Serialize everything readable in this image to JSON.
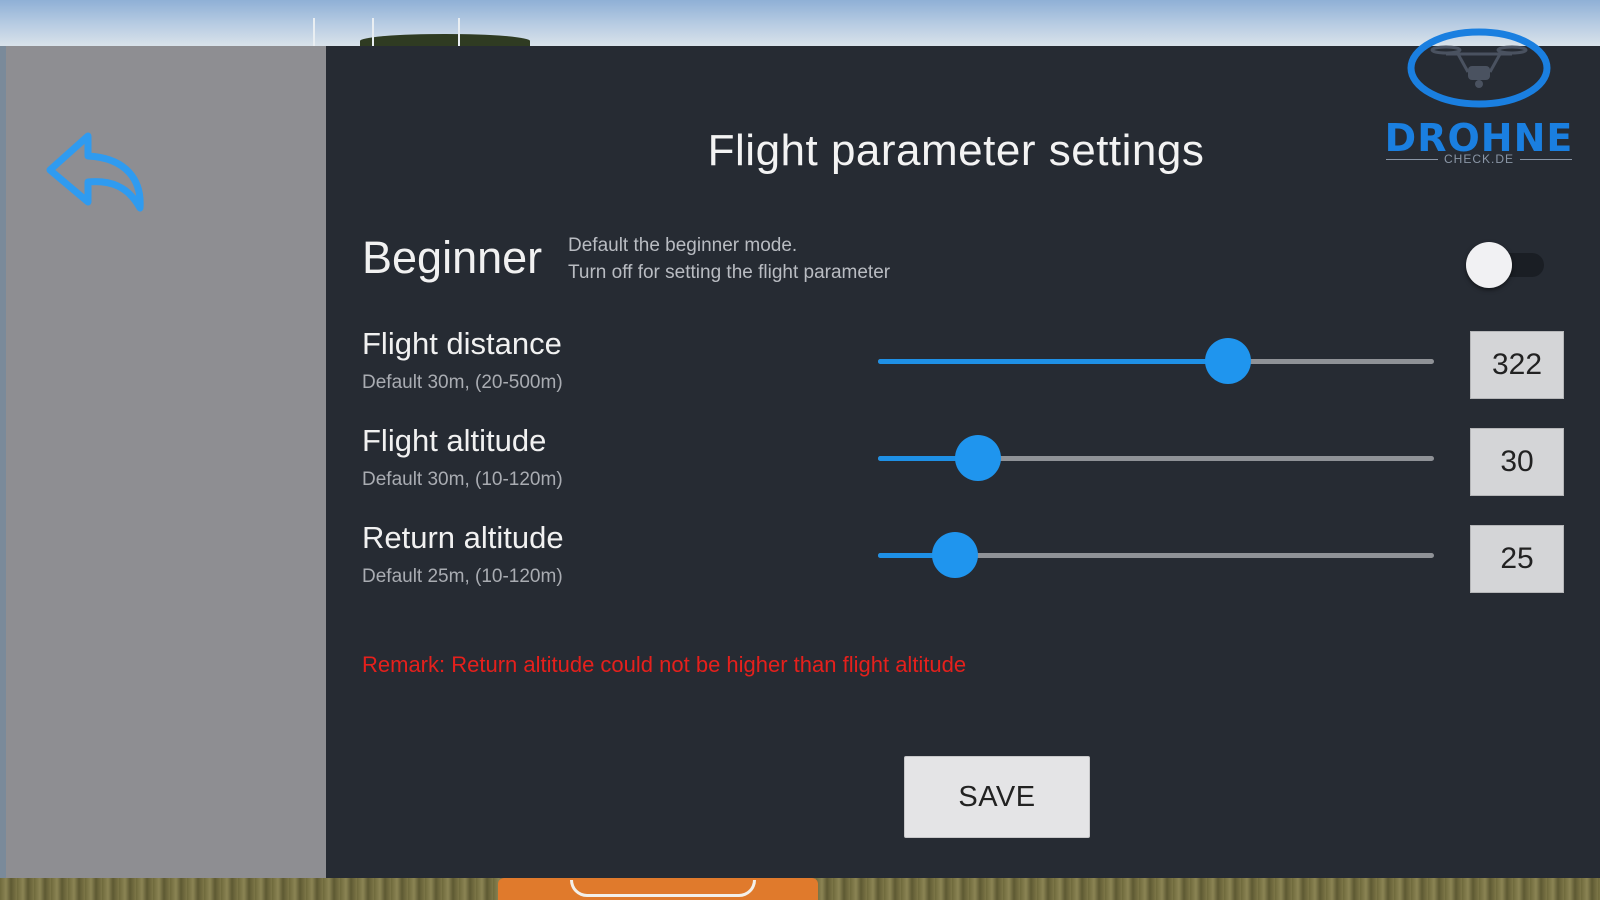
{
  "screen": {
    "title": "Flight parameter settings",
    "back_icon": "undo-arrow-icon"
  },
  "beginner": {
    "label": "Beginner",
    "desc_line1": "Default the beginner mode.",
    "desc_line2": "Turn off for setting the flight parameter",
    "toggle_on": false
  },
  "params": {
    "flight_distance": {
      "label": "Flight distance",
      "hint": "Default 30m, (20-500m)",
      "value": "322",
      "min": 20,
      "max": 500,
      "fill_fraction": 0.63
    },
    "flight_altitude": {
      "label": "Flight altitude",
      "hint": "Default 30m, (10-120m)",
      "value": "30",
      "min": 10,
      "max": 120,
      "fill_fraction": 0.18
    },
    "return_altitude": {
      "label": "Return altitude",
      "hint": "Default 25m, (10-120m)",
      "value": "25",
      "min": 10,
      "max": 120,
      "fill_fraction": 0.138
    }
  },
  "remark": "Remark: Return altitude could not be higher than flight altitude",
  "save_label": "SAVE",
  "logo": {
    "word": "DROHNE",
    "sub": "CHECK.DE",
    "icon": "drone-icon"
  },
  "colors": {
    "accent": "#1e90e6",
    "remark": "#e5201c",
    "panel": "#262b33",
    "sidebar": "#8e8e92"
  }
}
